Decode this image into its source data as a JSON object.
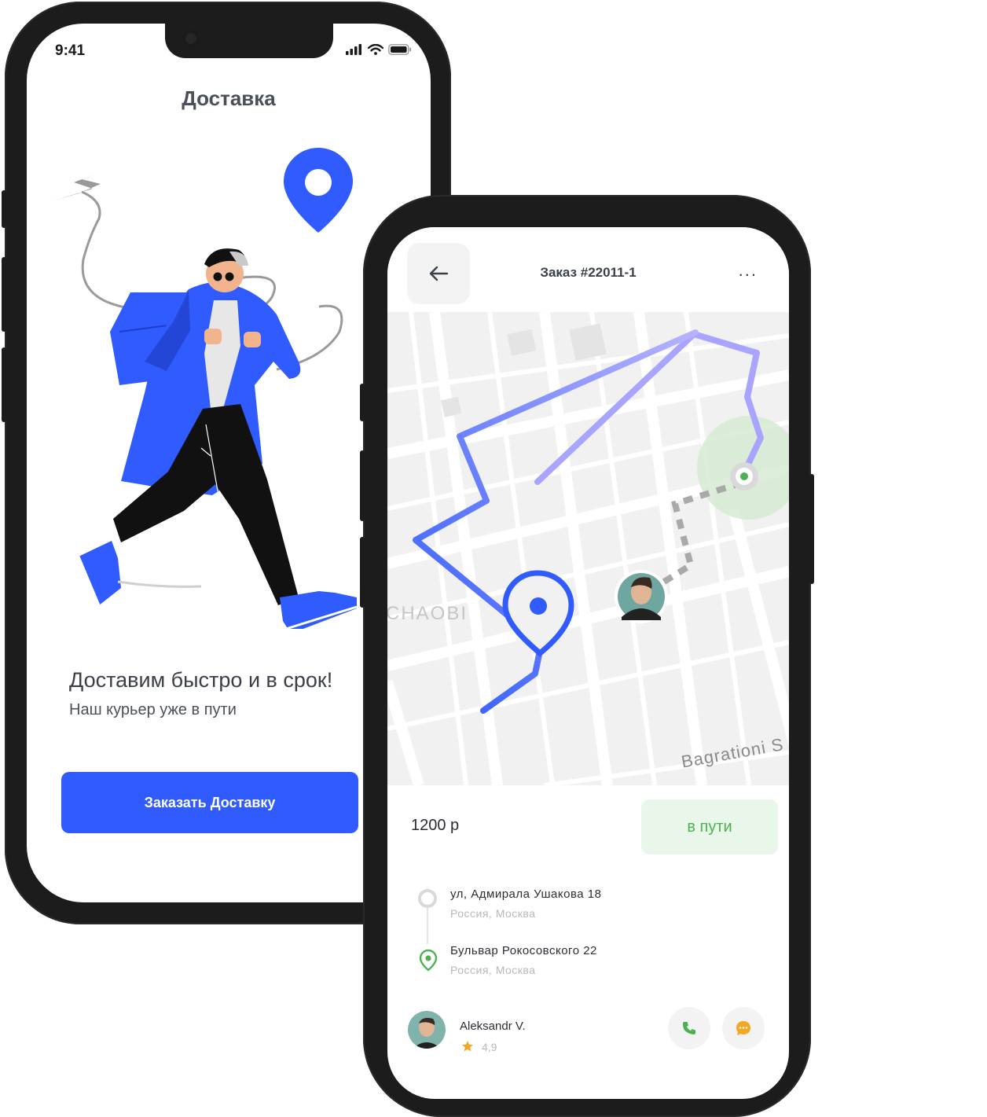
{
  "phone1": {
    "status_time": "9:41",
    "title": "Доставка",
    "headline": "Доставим быстро и в срок!",
    "subline": "Наш курьер уже в пути",
    "cta_label": "Заказать Доставку"
  },
  "phone2": {
    "order_title": "Заказ #22011-1",
    "more_label": "...",
    "map_labels": {
      "district": "CHAOBI",
      "street": "Bagrationi S"
    },
    "price": "1200 р",
    "status": "в пути",
    "route": [
      {
        "address": "ул, Адмирала Ушакова 18",
        "city": "Россия, Москва"
      },
      {
        "address": "Бульвар Рокосовского 22",
        "city": "Россия, Москва"
      }
    ],
    "courier": {
      "name": "Aleksandr V.",
      "rating": "4,9"
    }
  },
  "colors": {
    "accent": "#2f5bff",
    "success": "#4cb050",
    "rating_star": "#f5a623",
    "chat": "#f5a623"
  },
  "icons": [
    "back-arrow-icon",
    "phone-icon",
    "chat-icon",
    "star-icon",
    "location-pin-icon",
    "signal-icon",
    "wifi-icon",
    "battery-icon"
  ]
}
